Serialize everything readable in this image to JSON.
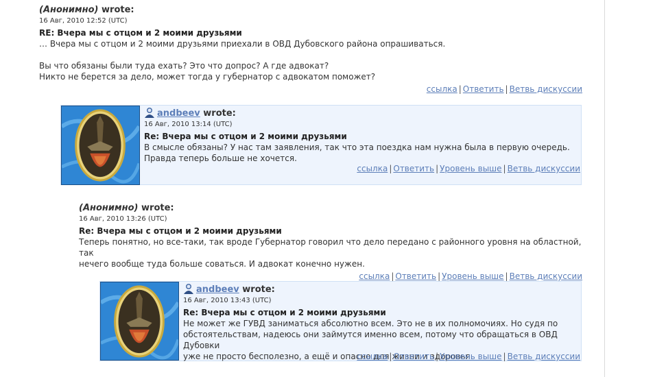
{
  "comments": [
    {
      "author": "(Анонимно)",
      "wrote": "wrote:",
      "date": "16 Авг, 2010 12:52 (UTC)",
      "subject": "RE: Вчера мы с отцом и 2 моими друзьями",
      "lines": [
        "… Вчера мы с отцом и 2 моими друзьями приехали в ОВД Дубовского района опрашиваться.",
        "",
        "Вы что обязаны были туда ехать? Это что допрос? А где адвокат?",
        "Никто не берется за дело, может тогда у губернатор с адвокатом поможет?"
      ],
      "links": [
        "ссылка",
        "Ответить",
        "Ветвь дискуссии"
      ]
    },
    {
      "author": "andbeev",
      "wrote": "wrote:",
      "date": "16 Авг, 2010 13:14 (UTC)",
      "subject": "Re: Вчера мы с отцом и 2 моими друзьями",
      "lines": [
        "В смысле обязаны? У нас там заявления, так что эта поездка нам нужна была в первую очередь.",
        "Правда теперь больше не хочется."
      ],
      "links": [
        "ссылка",
        "Ответить",
        "Уровень выше",
        "Ветвь дискуссии"
      ]
    },
    {
      "author": "(Анонимно)",
      "wrote": "wrote:",
      "date": "16 Авг, 2010 13:26 (UTC)",
      "subject": "Re: Вчера мы с отцом и 2 моими друзьями",
      "lines": [
        "Теперь понятно, но все-таки, так вроде Губернатор говорил что дело передано с районного уровня на областной, так",
        "нечего вообще туда больше соваться. И адвокат конечно нужен."
      ],
      "links": [
        "ссылка",
        "Ответить",
        "Уровень выше",
        "Ветвь дискуссии"
      ]
    },
    {
      "author": "andbeev",
      "wrote": "wrote:",
      "date": "16 Авг, 2010 13:43 (UTC)",
      "subject": "Re: Вчера мы с отцом и 2 моими друзьями",
      "lines": [
        "Не может же ГУВД заниматься абсолютно всем. Это не в их полномочиях. Но судя по",
        "обстоятельствам, надеюсь они займутся именно всем, потому что обращаться в ОВД Дубовки",
        "уже не просто бесполезно, а ещё и опасно для жизни и здоровья."
      ],
      "links": [
        "ссылка",
        "Ответить",
        "Уровень выше",
        "Ветвь дискуссии"
      ]
    }
  ],
  "colors": {
    "link": "#5c7eb8",
    "box_bg": "#eef4fd",
    "box_border": "#cfe0f5"
  },
  "icons": {
    "user": "user-head-icon",
    "avatar": "userpic-avatar"
  }
}
